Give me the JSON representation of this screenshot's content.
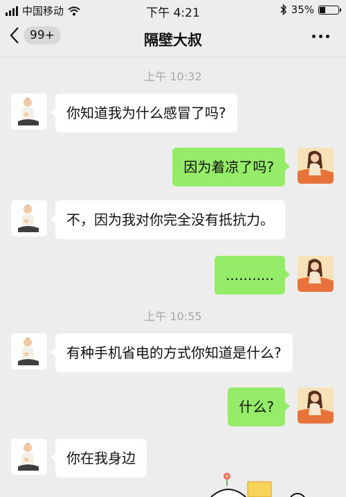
{
  "status_bar": {
    "carrier": "中国移动",
    "time": "下午 4:21",
    "battery": "35%",
    "battery_level": 0.35
  },
  "nav": {
    "back_badge": "99+",
    "title": "隔壁大叔",
    "back_icon": "chevron-left-icon",
    "more_icon": "more-dots-icon"
  },
  "messages": {
    "ts1": "上午 10:32",
    "m1": "你知道我为什么感冒了吗?",
    "m2": "因为着凉了吗?",
    "m3": "不，因为我对你完全没有抵抗力。",
    "m4": "...........",
    "ts2": "上午 10:55",
    "m5": "有种手机省电的方式你知道是什么?",
    "m6": "什么?",
    "m7": "你在我身边"
  },
  "colors": {
    "background": "#ededed",
    "outgoing_bubble": "#95ec69",
    "incoming_bubble": "#ffffff",
    "timestamp": "#a6a6a6"
  }
}
